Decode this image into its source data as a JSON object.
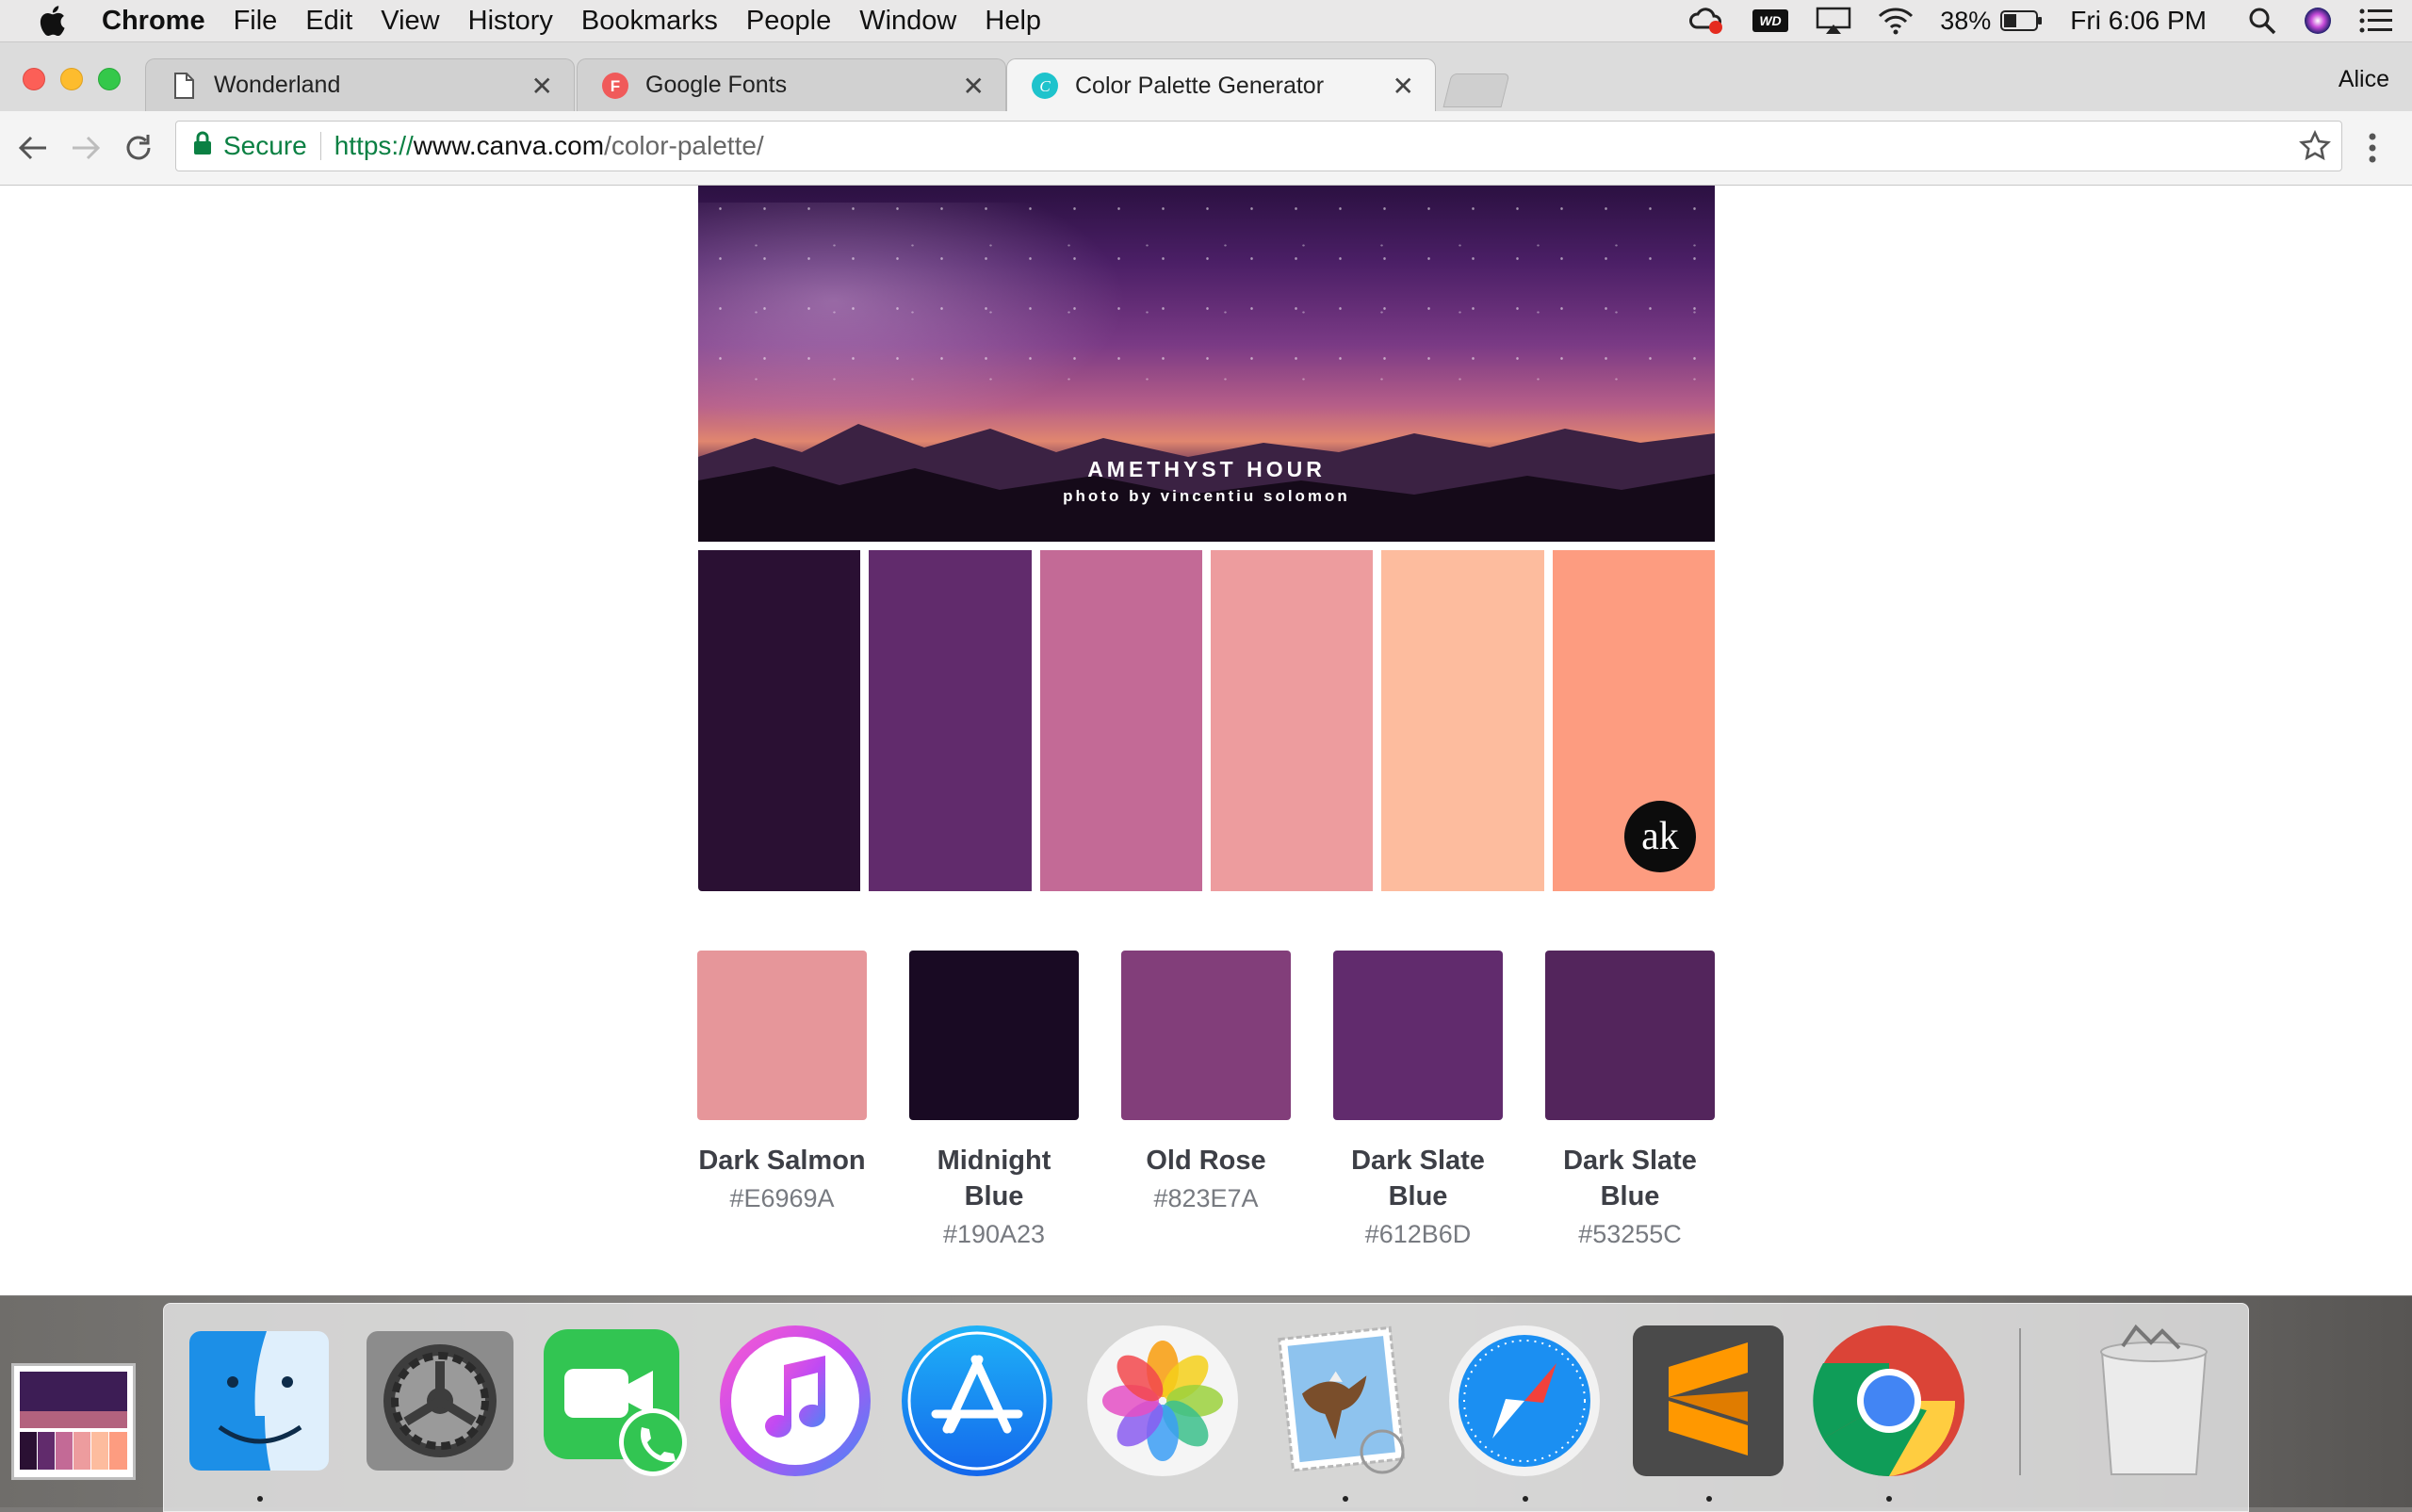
{
  "menubar": {
    "app_name": "Chrome",
    "items": [
      "File",
      "Edit",
      "View",
      "History",
      "Bookmarks",
      "People",
      "Window",
      "Help"
    ],
    "battery": "38%",
    "clock": "Fri 6:06 PM",
    "icons": [
      "creative-cloud-icon",
      "wd-icon",
      "airplay-icon",
      "wifi-icon",
      "battery-icon",
      "spotlight-icon",
      "siri-icon",
      "notification-center-icon"
    ]
  },
  "browser": {
    "tabs": [
      {
        "title": "Wonderland",
        "favicon": "document-icon"
      },
      {
        "title": "Google Fonts",
        "favicon": "google-fonts-icon"
      },
      {
        "title": "Color Palette Generator",
        "favicon": "canva-icon"
      }
    ],
    "profile_name": "Alice",
    "secure_label": "Secure",
    "url_scheme": "https://",
    "url_host": "www.canva.com",
    "url_path": "/color-palette/"
  },
  "page": {
    "hero_title": "AMETHYST HOUR",
    "hero_credit": "photo by vincentiu solomon",
    "watermark": "ak",
    "photo_palette": [
      "#2a1033",
      "#612b6c",
      "#c36a96",
      "#ed9c9e",
      "#fdbc9e",
      "#fd9c80"
    ],
    "swatches": [
      {
        "name": "Dark Salmon",
        "hex": "#E6969A"
      },
      {
        "name": "Midnight Blue",
        "hex": "#190A23"
      },
      {
        "name": "Old Rose",
        "hex": "#823E7A"
      },
      {
        "name": "Dark Slate Blue",
        "hex": "#612B6D"
      },
      {
        "name": "Dark Slate Blue",
        "hex": "#53255C"
      }
    ]
  },
  "dock": {
    "apps": [
      "finder-icon",
      "system-preferences-icon",
      "facetime-icon",
      "itunes-icon",
      "app-store-icon",
      "photos-icon",
      "mail-icon",
      "safari-icon",
      "sublime-text-icon",
      "chrome-icon",
      "trash-icon"
    ]
  }
}
